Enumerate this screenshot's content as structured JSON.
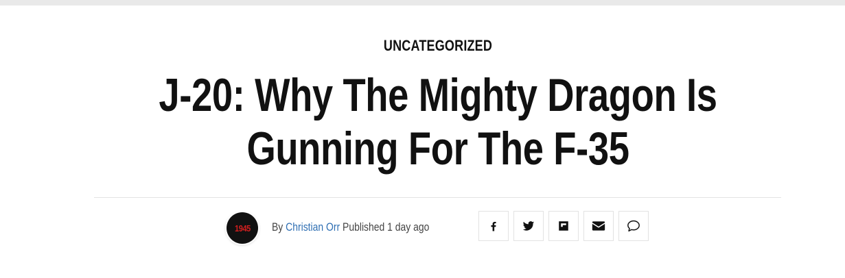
{
  "article": {
    "category": "UNCATEGORIZED",
    "title": "J-20: Why The Mighty Dragon Is Gunning For The F-35",
    "avatar_text": "1945",
    "byline": {
      "by_label": "By",
      "author": "Christian Orr",
      "published_label": "Published",
      "time_ago": "1 day ago"
    }
  },
  "share": {
    "buttons": [
      {
        "icon": "facebook-icon"
      },
      {
        "icon": "twitter-icon"
      },
      {
        "icon": "flipboard-icon"
      },
      {
        "icon": "email-icon"
      },
      {
        "icon": "comment-icon"
      }
    ]
  },
  "colors": {
    "author_link": "#2f6fb3",
    "avatar_text": "#d21f1f",
    "text": "#111111"
  }
}
